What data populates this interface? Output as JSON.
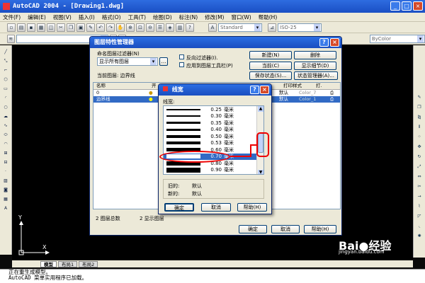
{
  "app": {
    "title": "AutoCAD 2004 - [Drawing1.dwg]"
  },
  "menu": [
    "文件(F)",
    "编辑(E)",
    "视图(V)",
    "插入(I)",
    "格式(O)",
    "工具(T)",
    "绘图(D)",
    "标注(N)",
    "修改(M)",
    "窗口(W)",
    "帮助(H)"
  ],
  "toolbar": {
    "text_style": "Standard",
    "dim_style": "ISO-25",
    "color_prop": "ByColor"
  },
  "layer_mgr": {
    "title": "图层特性管理器",
    "filter_label": "命名图层过滤器(N)",
    "filter_value": "显示所有图层",
    "invert_filter": "反向过滤器(I).",
    "apply_toolbar": "应用到图层工具栏(P)",
    "current_layer_label": "当前图层: 边界线",
    "btn_new": "新建(N)",
    "btn_delete": "删除",
    "btn_current": "当前(C)",
    "btn_details": "显示细节(D)",
    "btn_save_state": "保存状态(S)...",
    "btn_state_mgr": "状态管理器(A)...",
    "col_name": "名称",
    "col_on": "开",
    "col_plot_style": "打印样式",
    "col_plot": "打.",
    "rows": [
      {
        "name": "0",
        "lw": "默认",
        "style": "Color_7"
      },
      {
        "name": "边界线",
        "lw": "默认",
        "style": "Color_1"
      }
    ],
    "layer_count": "2 图层总数",
    "layer_shown": "2 显示图层",
    "btn_ok": "确定",
    "btn_cancel": "取消",
    "btn_help": "帮助(H)"
  },
  "lineweight": {
    "title": "线宽",
    "list_label": "线宽:",
    "items": [
      {
        "w": 0.25,
        "v": "0.25",
        "u": "毫米"
      },
      {
        "w": 0.3,
        "v": "0.30",
        "u": "毫米"
      },
      {
        "w": 0.35,
        "v": "0.35",
        "u": "毫米"
      },
      {
        "w": 0.4,
        "v": "0.40",
        "u": "毫米"
      },
      {
        "w": 0.5,
        "v": "0.50",
        "u": "毫米"
      },
      {
        "w": 0.53,
        "v": "0.53",
        "u": "毫米"
      },
      {
        "w": 0.6,
        "v": "0.60",
        "u": "毫米"
      },
      {
        "w": 0.7,
        "v": "0.70",
        "u": "毫米"
      },
      {
        "w": 0.8,
        "v": "0.80",
        "u": "毫米"
      },
      {
        "w": 0.9,
        "v": "0.90",
        "u": "毫米"
      }
    ],
    "selected": "0.70",
    "old_label": "旧的:",
    "old_value": "默认",
    "new_label": "新的:",
    "new_value": "默认",
    "btn_ok": "确定",
    "btn_cancel": "取消",
    "btn_help": "帮助(H)"
  },
  "tabs": [
    "模型",
    "布局1",
    "布局2"
  ],
  "command": [
    "正在重生成模型。",
    "AutoCAD 菜单实用程序已加载。"
  ],
  "watermark": {
    "brand": "Bai",
    "brand2": "经验",
    "site": "jingyan.baidu.com"
  }
}
